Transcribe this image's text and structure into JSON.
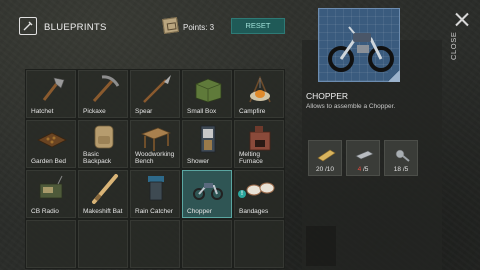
{
  "header": {
    "title": "BLUEPRINTS",
    "points_label": "Points: 3",
    "reset_label": "RESET",
    "close_label": "CLOSE"
  },
  "grid": {
    "items": [
      {
        "label": "Hatchet",
        "icon": "hatchet-icon"
      },
      {
        "label": "Pickaxe",
        "icon": "pickaxe-icon"
      },
      {
        "label": "Spear",
        "icon": "spear-icon"
      },
      {
        "label": "Small Box",
        "icon": "small-box-icon"
      },
      {
        "label": "Campfire",
        "icon": "campfire-icon"
      },
      {
        "label": "Garden Bed",
        "icon": "garden-bed-icon"
      },
      {
        "label": "Basic Backpack",
        "icon": "backpack-icon"
      },
      {
        "label": "Woodworking Bench",
        "icon": "woodworking-bench-icon"
      },
      {
        "label": "Shower",
        "icon": "shower-icon"
      },
      {
        "label": "Melting Furnace",
        "icon": "furnace-icon"
      },
      {
        "label": "CB Radio",
        "icon": "radio-icon"
      },
      {
        "label": "Makeshift Bat",
        "icon": "bat-icon"
      },
      {
        "label": "Rain Catcher",
        "icon": "rain-catcher-icon"
      },
      {
        "label": "Chopper",
        "icon": "chopper-icon",
        "selected": true
      },
      {
        "label": "Bandages",
        "icon": "bandages-icon",
        "alert": "!"
      }
    ]
  },
  "detail": {
    "title": "CHOPPER",
    "description": "Allows to assemble a Chopper.",
    "resources": [
      {
        "icon": "wood-plank-icon",
        "have": "20",
        "need": "/10"
      },
      {
        "icon": "metal-bar-icon",
        "have": "4",
        "need": "/5",
        "have_color": "#e04a3c"
      },
      {
        "icon": "nuts-bolts-icon",
        "have": "18",
        "need": "/5"
      }
    ]
  },
  "colors": {
    "accent": "#2aa59c",
    "reset_bg": "#1f5a57",
    "selected_cell": "#2f5554",
    "insufficient": "#e04a3c"
  }
}
